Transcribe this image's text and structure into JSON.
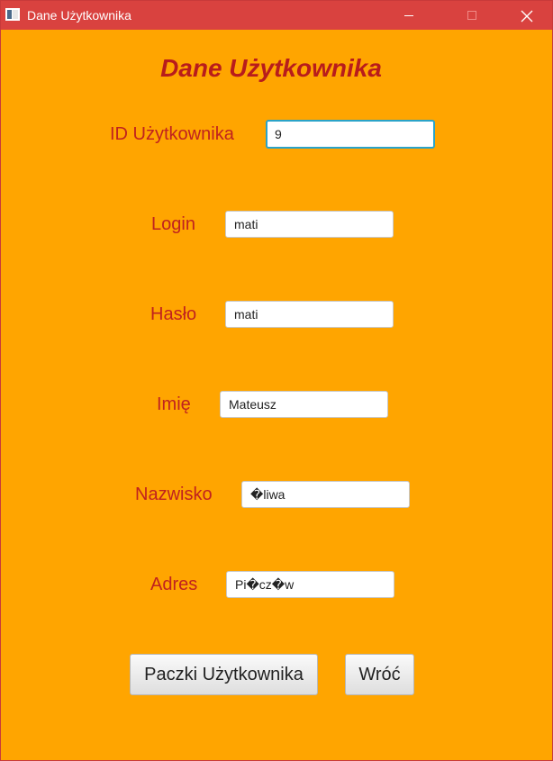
{
  "window": {
    "title": "Dane Użytkownika",
    "accent_color": "#d9423f",
    "background_color": "#ffa500"
  },
  "form": {
    "heading": "Dane Użytkownika",
    "heading_color": "#b81c1c",
    "label_color": "#c0221f",
    "fields": {
      "user_id": {
        "label": "ID Użytkownika",
        "value": "9"
      },
      "login": {
        "label": "Login",
        "value": "mati"
      },
      "password": {
        "label": "Hasło",
        "value": "mati"
      },
      "first_name": {
        "label": "Imię",
        "value": "Mateusz"
      },
      "last_name": {
        "label": "Nazwisko",
        "value": "�liwa"
      },
      "address": {
        "label": "Adres",
        "value": "Pi�cz�w"
      }
    }
  },
  "buttons": {
    "user_parcels": "Paczki Użytkownika",
    "back": "Wróć"
  }
}
